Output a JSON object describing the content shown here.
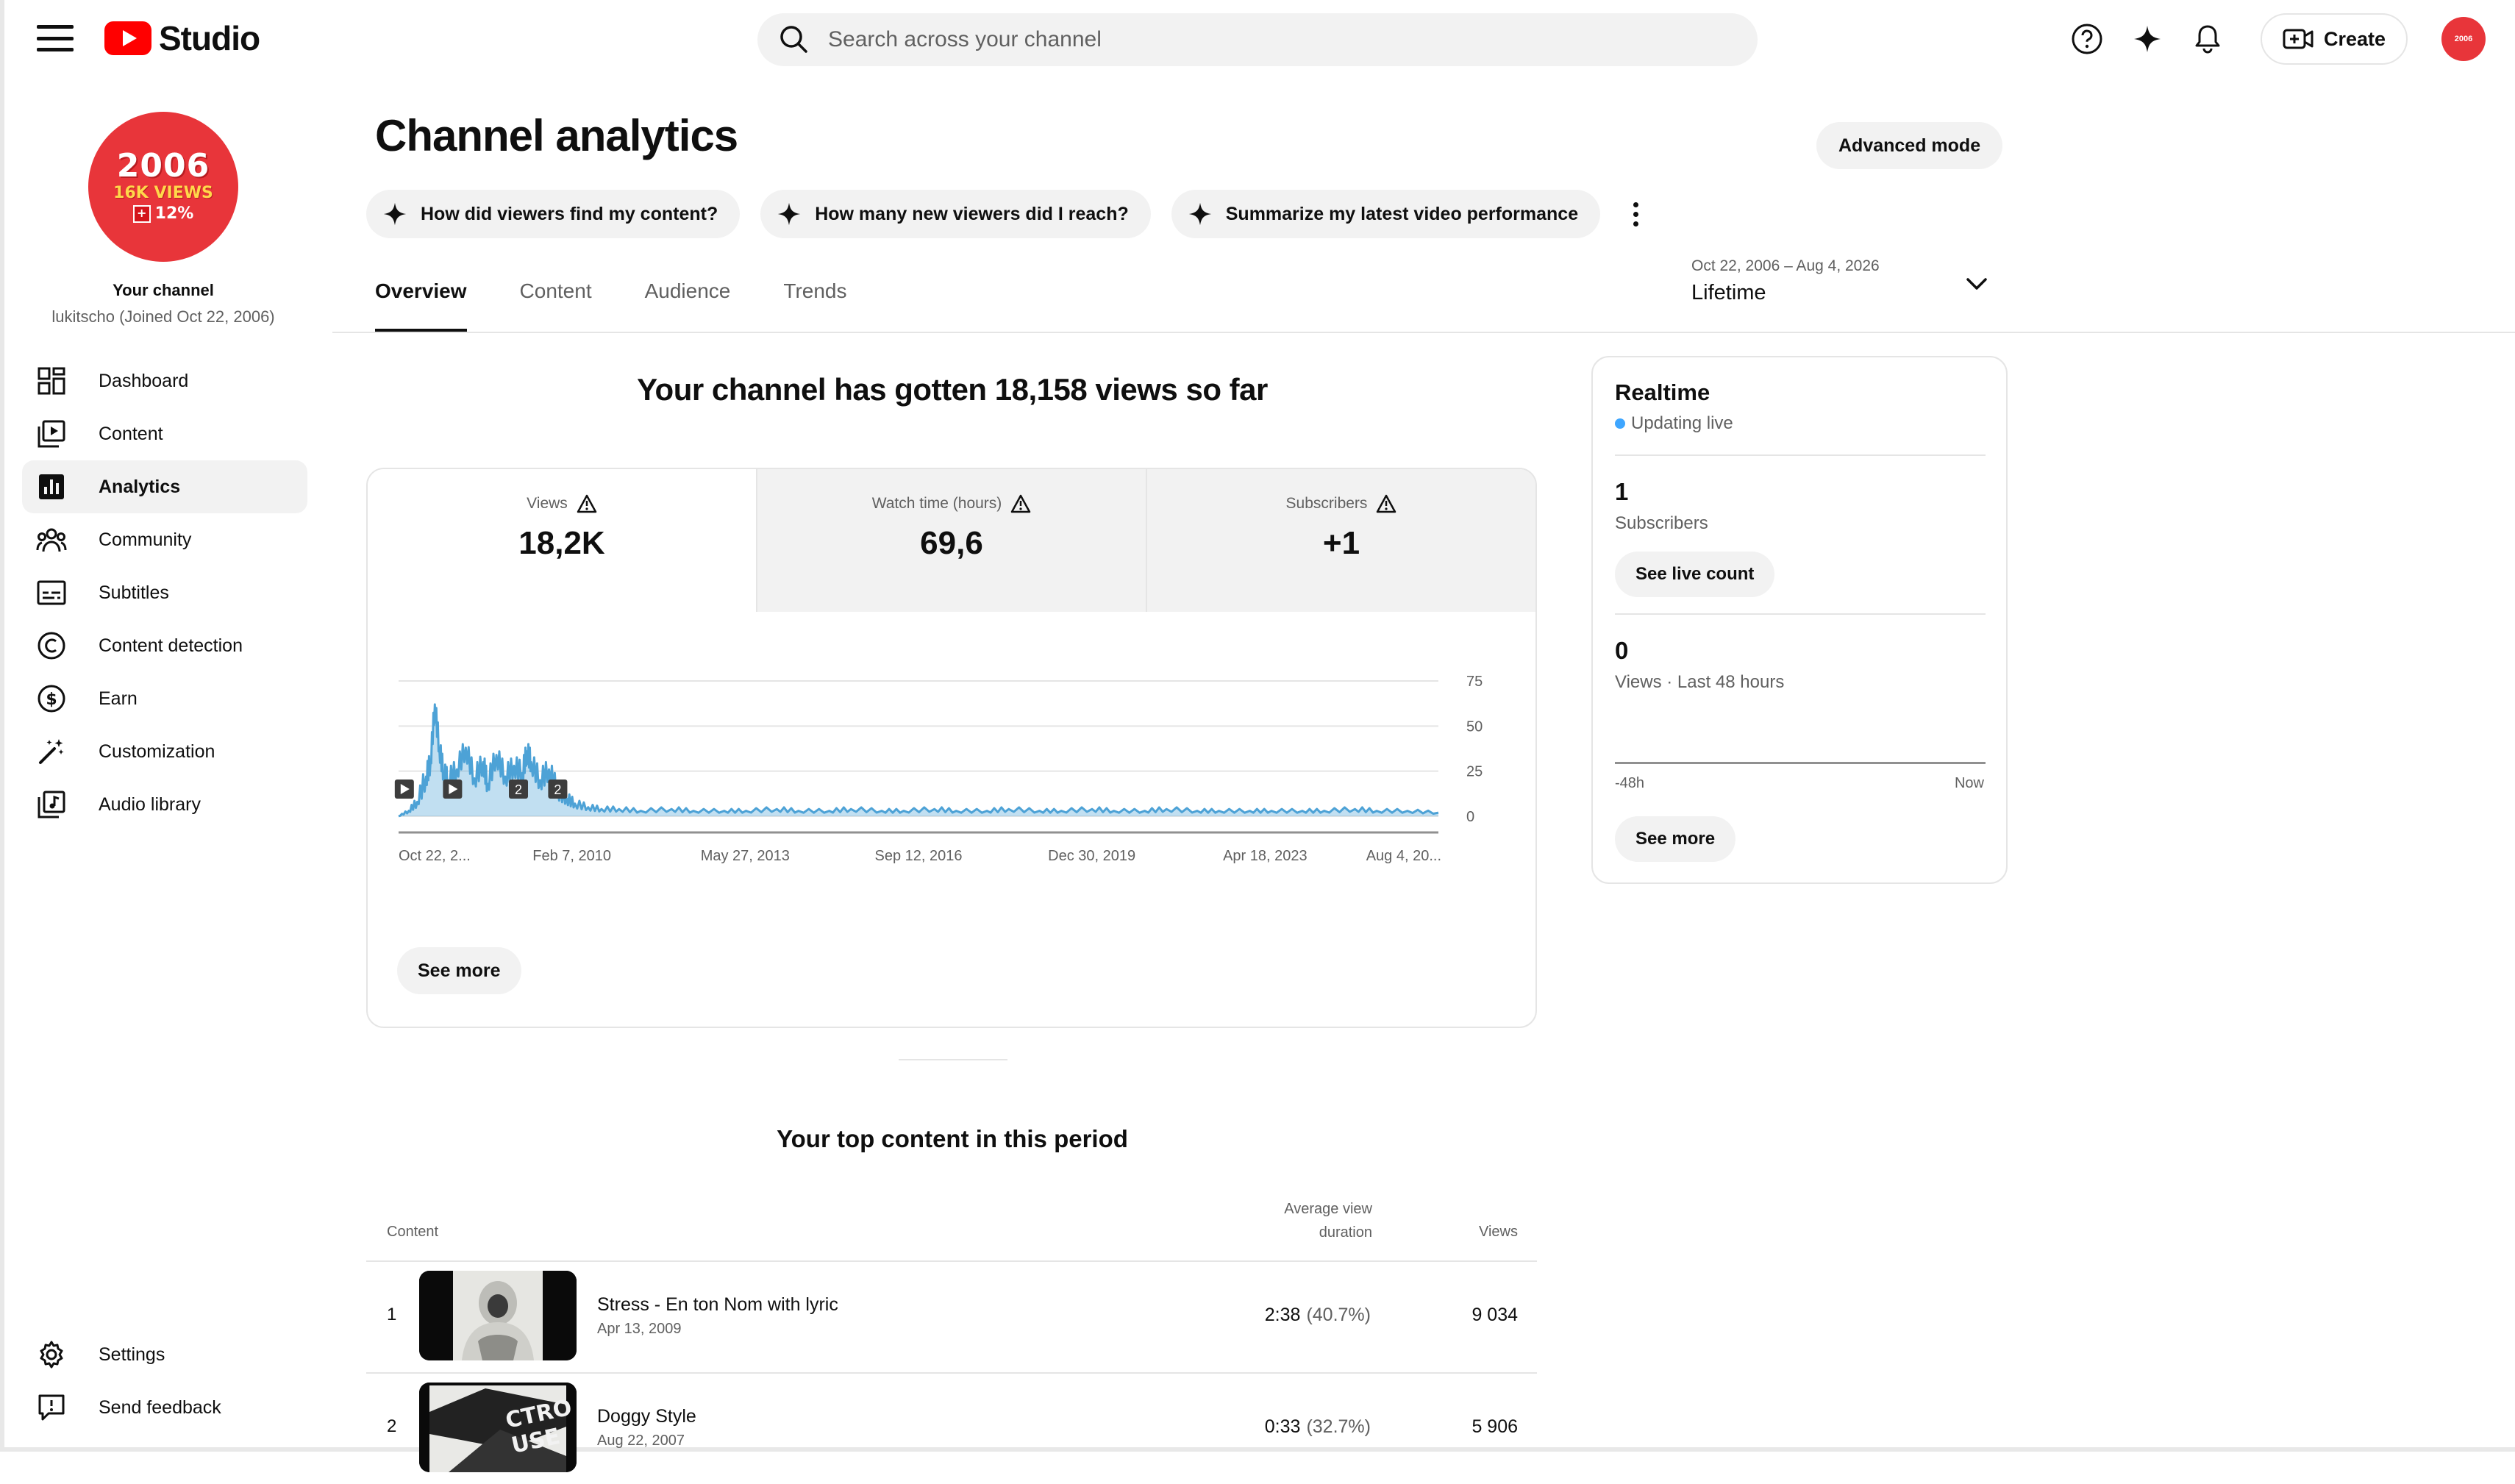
{
  "app": {
    "logo_text": "Studio"
  },
  "search": {
    "placeholder": "Search across your channel"
  },
  "topbar": {
    "create_label": "Create"
  },
  "channel": {
    "your_channel_label": "Your channel",
    "handle": "lukitscho (Joined Oct 22, 2006)"
  },
  "avatar": {
    "line1": "2006",
    "line2": "16K VIEWS",
    "line3": "12%"
  },
  "sidebar": {
    "items": [
      {
        "label": "Dashboard",
        "icon": "dashboard-icon"
      },
      {
        "label": "Content",
        "icon": "content-icon"
      },
      {
        "label": "Analytics",
        "icon": "analytics-icon",
        "active": true
      },
      {
        "label": "Community",
        "icon": "community-icon"
      },
      {
        "label": "Subtitles",
        "icon": "subtitles-icon"
      },
      {
        "label": "Content detection",
        "icon": "copyright-icon"
      },
      {
        "label": "Earn",
        "icon": "dollar-icon"
      },
      {
        "label": "Customization",
        "icon": "magic-wand-icon"
      },
      {
        "label": "Audio library",
        "icon": "audio-library-icon"
      }
    ],
    "bottom": [
      {
        "label": "Settings",
        "icon": "gear-icon"
      },
      {
        "label": "Send feedback",
        "icon": "feedback-icon"
      }
    ]
  },
  "page": {
    "title": "Channel analytics",
    "advanced_mode": "Advanced mode"
  },
  "chips": [
    "How did viewers find my content?",
    "How many new viewers did I reach?",
    "Summarize my latest video performance"
  ],
  "tabs": [
    "Overview",
    "Content",
    "Audience",
    "Trends"
  ],
  "date_range": {
    "range": "Oct 22, 2006 – Aug 4, 2026",
    "label": "Lifetime"
  },
  "overview": {
    "headline": "Your channel has gotten 18,158 views so far",
    "metrics": [
      {
        "label": "Views",
        "value": "18,2K"
      },
      {
        "label": "Watch time (hours)",
        "value": "69,6"
      },
      {
        "label": "Subscribers",
        "value": "+1"
      }
    ],
    "see_more": "See more"
  },
  "chart_data": {
    "type": "line",
    "series": [
      {
        "x": [
          "2006-10-22",
          "2007-01",
          "2007-03",
          "2007-05",
          "2007-06",
          "2007-07",
          "2007-08",
          "2007-09",
          "2007-10",
          "2007-12",
          "2008-02",
          "2008-04",
          "2008-06",
          "2008-07",
          "2008-09",
          "2008-11",
          "2009-01",
          "2009-03",
          "2009-04",
          "2009-05",
          "2009-07",
          "2009-09",
          "2009-11",
          "2010-01",
          "2010-03",
          "2010-06",
          "2010-09",
          "2011-01",
          "2011-06",
          "2012-01",
          "2012-06",
          "2013-01",
          "2013-06",
          "2014-01",
          "2014-06",
          "2015-01",
          "2015-06",
          "2016-01",
          "2016-06",
          "2017-01",
          "2017-06",
          "2018-01",
          "2018-06",
          "2019-01",
          "2019-06",
          "2020-01",
          "2020-06",
          "2021-01",
          "2021-06",
          "2022-01",
          "2022-06",
          "2023-01",
          "2023-06",
          "2024-01",
          "2024-06",
          "2025-01",
          "2025-06",
          "2026-01",
          "2026-08-04"
        ],
        "y": [
          0,
          3,
          8,
          22,
          30,
          62,
          38,
          24,
          20,
          26,
          38,
          21,
          30,
          18,
          34,
          22,
          28,
          24,
          36,
          30,
          20,
          26,
          14,
          10,
          7,
          5,
          4,
          4,
          3,
          4,
          3,
          3,
          3,
          4,
          3,
          3,
          4,
          3,
          3,
          4,
          3,
          3,
          4,
          3,
          3,
          4,
          3,
          3,
          4,
          3,
          3,
          3,
          3,
          3,
          3,
          4,
          3,
          3,
          2
        ]
      }
    ],
    "x_tick_labels": [
      "Oct 22, 2...",
      "Feb 7, 2010",
      "May 27, 2013",
      "Sep 12, 2016",
      "Dec 30, 2019",
      "Apr 18, 2023",
      "Aug 4, 20..."
    ],
    "y_ticks": [
      75,
      50,
      25,
      0
    ],
    "ylim": [
      0,
      75
    ],
    "grid": true,
    "markers": [
      {
        "x": "2006-12",
        "kind": "play"
      },
      {
        "x": "2007-11",
        "kind": "play"
      },
      {
        "x": "2009-02",
        "kind": "count",
        "label": "2"
      },
      {
        "x": "2009-11",
        "kind": "count",
        "label": "2"
      }
    ]
  },
  "top_content": {
    "title": "Your top content in this period",
    "headers": {
      "content": "Content",
      "avd_line1": "Average view",
      "avd_line2": "duration",
      "views": "Views"
    },
    "rows": [
      {
        "rank": "1",
        "title": "Stress - En ton Nom with lyric",
        "date": "Apr 13, 2009",
        "avd": "2:38",
        "avd_pct": "(40.7%)",
        "views": "9 034"
      },
      {
        "rank": "2",
        "title": "Doggy Style",
        "date": "Aug 22, 2007",
        "avd": "0:33",
        "avd_pct": "(32.7%)",
        "views": "5 906"
      }
    ]
  },
  "realtime": {
    "title": "Realtime",
    "status": "Updating live",
    "subscribers_value": "1",
    "subscribers_label": "Subscribers",
    "see_live_count": "See live count",
    "views_value": "0",
    "views_label": "Views · Last 48 hours",
    "axis_left": "-48h",
    "axis_right": "Now",
    "see_more": "See more",
    "live_color": "#3ea6ff"
  },
  "colors": {
    "chart_line": "#4da2d6",
    "brand_red": "#ff0000",
    "avatar_red": "#e8353a"
  }
}
